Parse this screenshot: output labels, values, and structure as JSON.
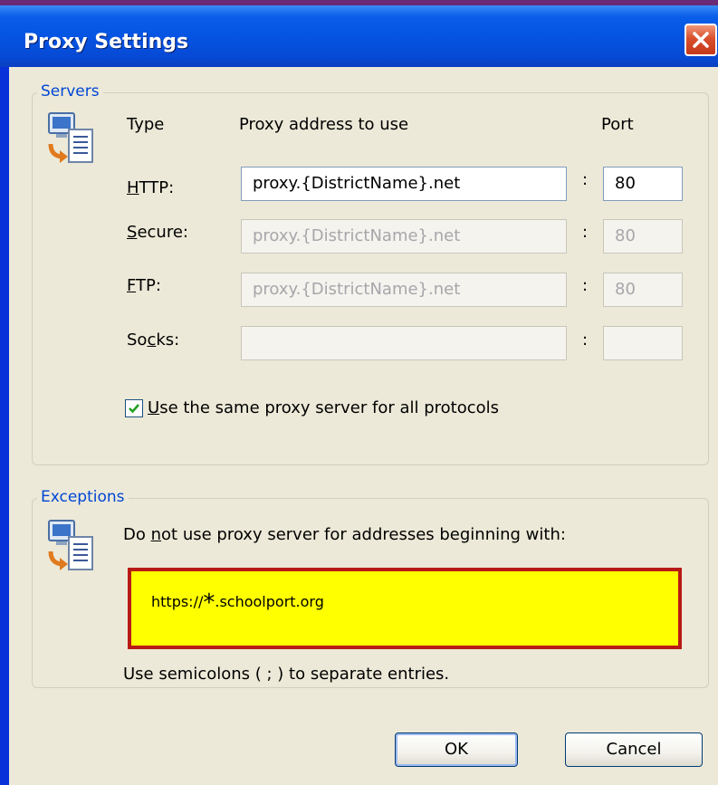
{
  "window": {
    "title": "Proxy Settings"
  },
  "servers": {
    "group_title": "Servers",
    "col_type": "Type",
    "col_address": "Proxy address to use",
    "col_port": "Port",
    "rows": [
      {
        "label_pre": "",
        "label_key": "H",
        "label_post": "TTP:",
        "address": "proxy.{DistrictName}.net",
        "port": "80",
        "enabled": true
      },
      {
        "label_pre": "",
        "label_key": "S",
        "label_post": "ecure:",
        "address": "proxy.{DistrictName}.net",
        "port": "80",
        "enabled": false
      },
      {
        "label_pre": "",
        "label_key": "F",
        "label_post": "TP:",
        "address": "proxy.{DistrictName}.net",
        "port": "80",
        "enabled": false
      },
      {
        "label_pre": "So",
        "label_key": "c",
        "label_post": "ks:",
        "address": "",
        "port": "",
        "enabled": false
      }
    ],
    "colon": ":",
    "same_proxy": {
      "key": "U",
      "rest": "se the same proxy server for all protocols",
      "checked": true
    }
  },
  "exceptions": {
    "group_title": "Exceptions",
    "desc_pre": "Do ",
    "desc_key": "n",
    "desc_post": "ot use proxy server for addresses beginning with:",
    "value_prefix": "https://",
    "value_star": "*",
    "value_suffix": ".schoolport.org",
    "note": "Use semicolons ( ; ) to separate entries."
  },
  "buttons": {
    "ok": "OK",
    "cancel": "Cancel"
  },
  "colors": {
    "highlight_fill": "#ffff00",
    "highlight_border": "#b81a16",
    "group_title": "#0046d5"
  }
}
